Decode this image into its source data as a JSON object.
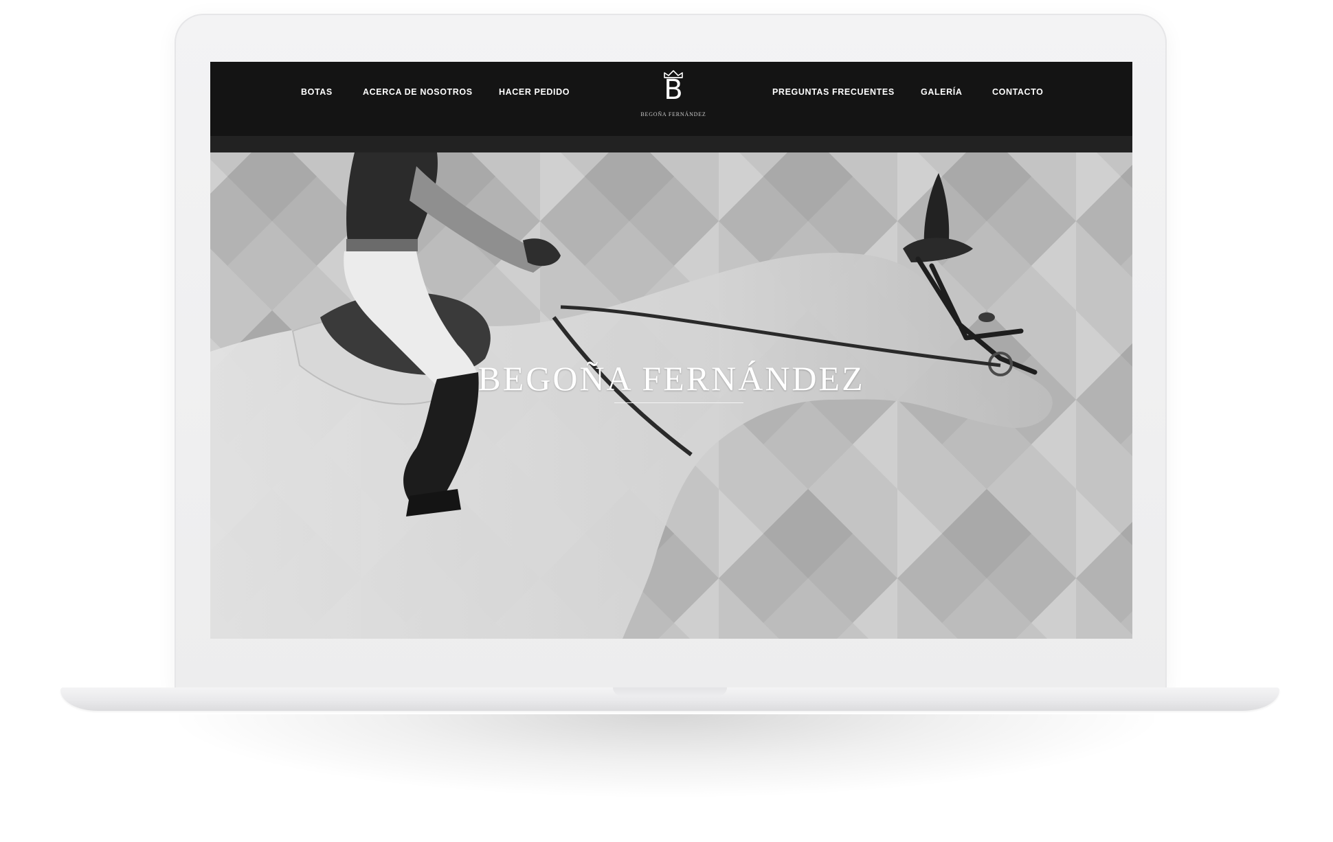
{
  "nav": {
    "left": [
      "BOTAS",
      "ACERCA DE NOSOTROS",
      "HACER PEDIDO"
    ],
    "right": [
      "PREGUNTAS FRECUENTES",
      "GALERÍA",
      "CONTACTO"
    ]
  },
  "logo": {
    "letter": "B",
    "text": "BEGOÑA FERNÁNDEZ",
    "icon": "crown-icon"
  },
  "hero": {
    "title": "BEGOÑA FERNÁNDEZ"
  },
  "colors": {
    "navbar": "#141414",
    "hero_background": "#c2c2c2",
    "text": "#ffffff"
  }
}
